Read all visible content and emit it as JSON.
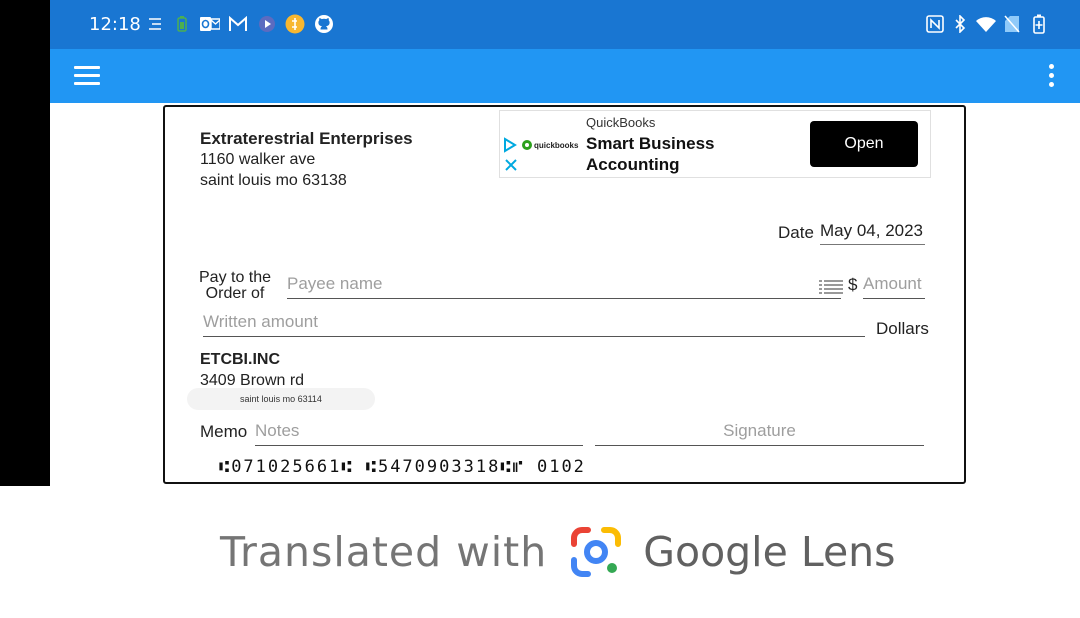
{
  "status_bar": {
    "time": "12:18",
    "left_icons": [
      "flow-icon",
      "battery-saver-icon",
      "outlook-icon",
      "gmail-icon",
      "play-icon",
      "coin-icon",
      "github-icon"
    ],
    "right_icons": [
      "nfc-icon",
      "bluetooth-icon",
      "wifi-icon",
      "no-sim-icon",
      "battery-charging-icon"
    ],
    "color": "#1976d2"
  },
  "app_bar": {
    "color": "#2196f3",
    "menu_icon": "hamburger-menu-icon",
    "overflow_icon": "more-vert-icon"
  },
  "check": {
    "payer": {
      "name": "Extraterestrial Enterprises",
      "address1": "1160 walker ave",
      "address2": "saint louis mo 63138"
    },
    "ad": {
      "brand": "QuickBooks",
      "headline_line1": "Smart Business",
      "headline_line2": "Accounting",
      "button": "Open"
    },
    "date_label": "Date",
    "date_value": "May 04, 2023",
    "pay_to_line1": "Pay to the",
    "pay_to_line2": "Order of",
    "payee_placeholder": "Payee name",
    "dollar_sign": "$",
    "amount_placeholder": "Amount",
    "written_placeholder": "Written amount",
    "dollars_label": "Dollars",
    "bank": {
      "name": "ETCBI.INC",
      "address1": "3409 Brown rd",
      "address2": "saint louis mo 63114"
    },
    "memo_label": "Memo",
    "memo_placeholder": "Notes",
    "signature_placeholder": "Signature",
    "micr_routing": "⑆071025661⑆",
    "micr_account": "⑆5470903318⑆⑈",
    "micr_check_number": "0102"
  },
  "footer": {
    "text1": "Translated with",
    "text2": "Google Lens"
  },
  "colors": {
    "accent": "#2196f3",
    "status": "#1976d2",
    "lens_blue": "#4285f4",
    "lens_red": "#ea4335",
    "lens_yellow": "#fbbc04",
    "lens_green": "#34a853"
  }
}
